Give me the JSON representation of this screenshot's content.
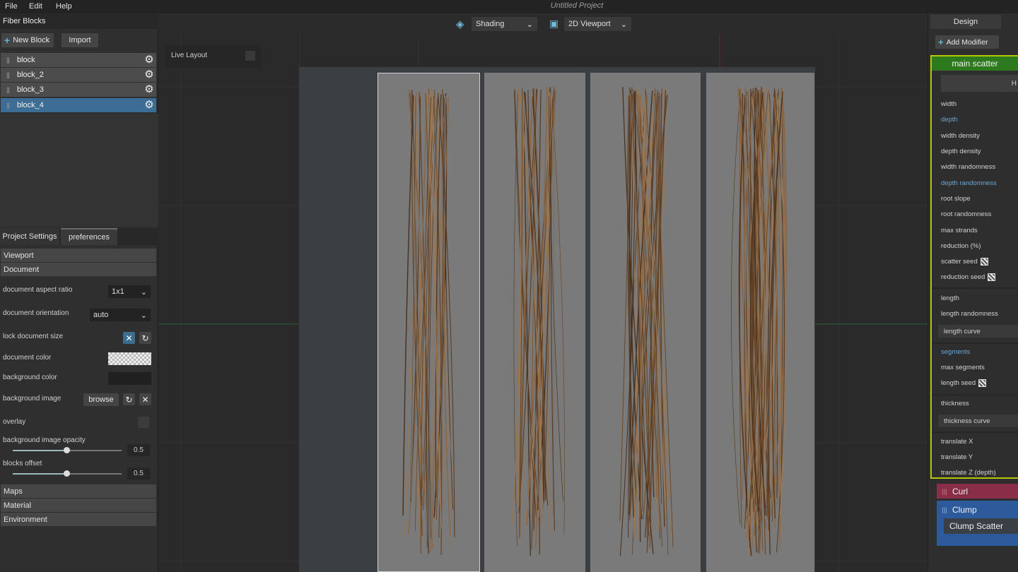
{
  "menu": {
    "file": "File",
    "edit": "Edit",
    "help": "Help",
    "title": "Untitled Project"
  },
  "fiber_blocks": {
    "header": "Fiber Blocks",
    "new_block": "New Block",
    "import": "Import",
    "blocks": [
      {
        "name": "block"
      },
      {
        "name": "block_2"
      },
      {
        "name": "block_3"
      },
      {
        "name": "block_4"
      }
    ]
  },
  "settings": {
    "tab_project": "Project Settings",
    "tab_preferences": "preferences",
    "section_viewport": "Viewport",
    "section_document": "Document",
    "aspect_ratio_label": "document aspect ratio",
    "aspect_ratio_value": "1x1",
    "orientation_label": "document orientation",
    "orientation_value": "auto",
    "lock_size_label": "lock document size",
    "doc_color_label": "document color",
    "bg_color_label": "background color",
    "bg_image_label": "background image",
    "browse": "browse",
    "overlay_label": "overlay",
    "bg_opacity_label": "background image opacity",
    "bg_opacity_value": "0.5",
    "blocks_offset_label": "blocks offset",
    "blocks_offset_value": "0.5",
    "section_maps": "Maps",
    "section_material": "Material",
    "section_environment": "Environment"
  },
  "toolbar": {
    "shading": "Shading",
    "viewport": "2D Viewport",
    "live_layout": "Live Layout"
  },
  "design": {
    "tab": "Design",
    "add_modifier": "Add Modifier",
    "main_scatter": "main scatter",
    "button_partial": "H",
    "props1": [
      "width",
      "depth",
      "width density",
      "depth density",
      "width randomness",
      "depth randomness",
      "root slope",
      "root randomness",
      "max strands",
      "reduction (%)",
      "scatter seed",
      "reduction seed"
    ],
    "props2": [
      "length",
      "length randomness"
    ],
    "length_curve": "length curve",
    "props3": [
      "segments",
      "max segments",
      "length seed"
    ],
    "thickness": "thickness",
    "thickness_curve": "thickness curve",
    "props4": [
      "translate X",
      "translate Y",
      "translate Z (depth)"
    ],
    "curl": "Curl",
    "clump": "Clump",
    "clump_scatter": "Clump Scatter"
  },
  "colors": {
    "selected_block": "#3d6d94",
    "main_scatter": "#2d7a1e",
    "curl": "#8a2d48",
    "clump": "#2c5a9a"
  }
}
